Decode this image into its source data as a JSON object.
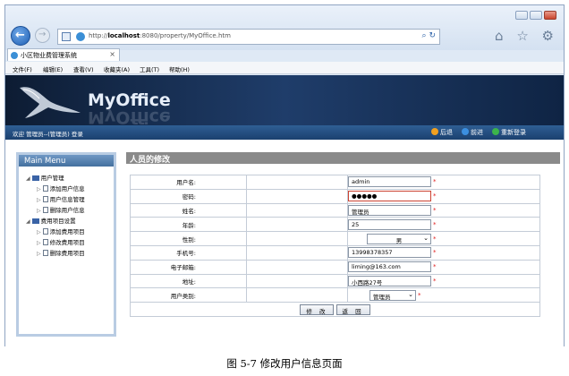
{
  "browser": {
    "url_prefix": "http://",
    "url_host": "localhost",
    "url_rest": ":8080/property/MyOffice.htm",
    "tab_title": "小区物业费管理系统",
    "tab_close": "×",
    "back_icon": "←",
    "forward_icon": "→",
    "search_icon": "⌕",
    "refresh_icon": "↻",
    "tool_icons": "⌂ ☆ ⚙"
  },
  "menu": [
    "文件(F)",
    "编辑(E)",
    "查看(V)",
    "收藏夹(A)",
    "工具(T)",
    "帮助(H)"
  ],
  "banner": {
    "title": "MyOffice"
  },
  "infobar": {
    "welcome": "欢迎 管理员--(管理员) 登录",
    "back": "后退",
    "forward": "前进",
    "relogin": "重新登录"
  },
  "sidebar": {
    "title": "Main Menu",
    "groups": [
      {
        "label": "用户管理",
        "items": [
          "添加用户信息",
          "用户信息管理",
          "删除用户信息"
        ]
      },
      {
        "label": "费用项目设置",
        "items": [
          "添加费用项目",
          "修改费用项目",
          "删除费用项目"
        ]
      }
    ]
  },
  "content": {
    "title": "人员的修改"
  },
  "form": {
    "username_label": "用户名:",
    "username_value": "admin",
    "password_label": "密码:",
    "password_value": "●●●●●",
    "name_label": "姓名:",
    "name_value": "管理员",
    "age_label": "年龄:",
    "age_value": "25",
    "gender_label": "性别:",
    "gender_value": "男",
    "phone_label": "手机号:",
    "phone_value": "13998378357",
    "email_label": "电子邮箱:",
    "email_value": "liming@163.com",
    "address_label": "地址:",
    "address_value": "小西路27号",
    "usertype_label": "用户类别:",
    "usertype_value": "管理员",
    "required_mark": "*",
    "modify_button": "修 改",
    "back_button": "返 回"
  },
  "caption": "图 5-7 修改用户信息页面"
}
